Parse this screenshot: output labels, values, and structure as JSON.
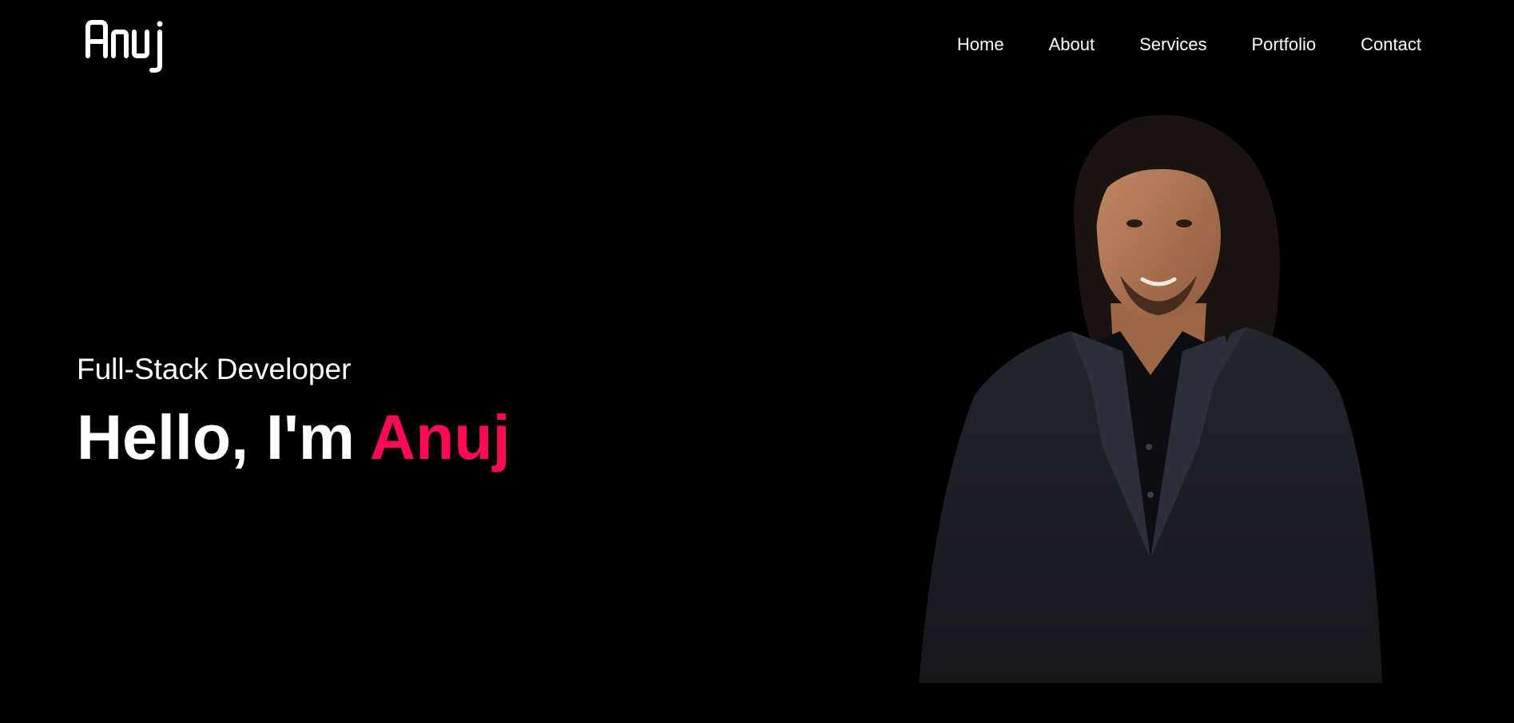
{
  "header": {
    "logo_text": "Anuj",
    "nav": [
      {
        "label": "Home"
      },
      {
        "label": "About"
      },
      {
        "label": "Services"
      },
      {
        "label": "Portfolio"
      },
      {
        "label": "Contact"
      }
    ]
  },
  "hero": {
    "subtitle": "Full-Stack Developer",
    "greeting": "Hello, I'm ",
    "name": "Anuj"
  },
  "colors": {
    "background": "#000000",
    "text": "#ffffff",
    "accent": "#ff0a54"
  },
  "portrait": {
    "icon": "person-portrait"
  }
}
